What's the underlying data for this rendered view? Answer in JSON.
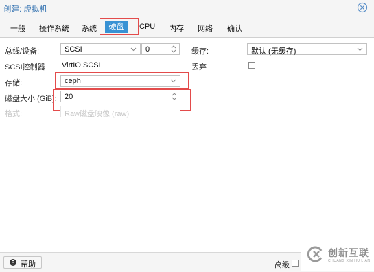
{
  "window": {
    "title": "创建: 虚拟机"
  },
  "tabs": [
    {
      "label": "一般"
    },
    {
      "label": "操作系统"
    },
    {
      "label": "系统"
    },
    {
      "label": "硬盘"
    },
    {
      "label": "CPU"
    },
    {
      "label": "内存"
    },
    {
      "label": "网络"
    },
    {
      "label": "确认"
    }
  ],
  "active_tab": "硬盘",
  "form": {
    "bus_label": "总线/设备:",
    "bus_value": "SCSI",
    "bus_index": "0",
    "scsi_controller_label": "SCSI控制器",
    "scsi_controller_value": "VirtIO SCSI",
    "storage_label": "存储:",
    "storage_value": "ceph",
    "disk_size_label": "磁盘大小 (GiB):",
    "disk_size_value": "20",
    "format_label": "格式:",
    "format_value": "Raw磁盘映像 (raw)",
    "cache_label": "缓存:",
    "cache_value": "默认 (无缓存)",
    "discard_label": "丢弃",
    "discard_checked": false
  },
  "footer": {
    "help_label": "帮助",
    "advanced_label": "高级",
    "advanced_checked": false
  },
  "watermark": {
    "text": "创新互联",
    "subtext": "CHUANG XIN HU LIAN"
  },
  "colors": {
    "accent": "#3892d4",
    "title": "#3c78b4",
    "highlight": "#e34b4b"
  }
}
